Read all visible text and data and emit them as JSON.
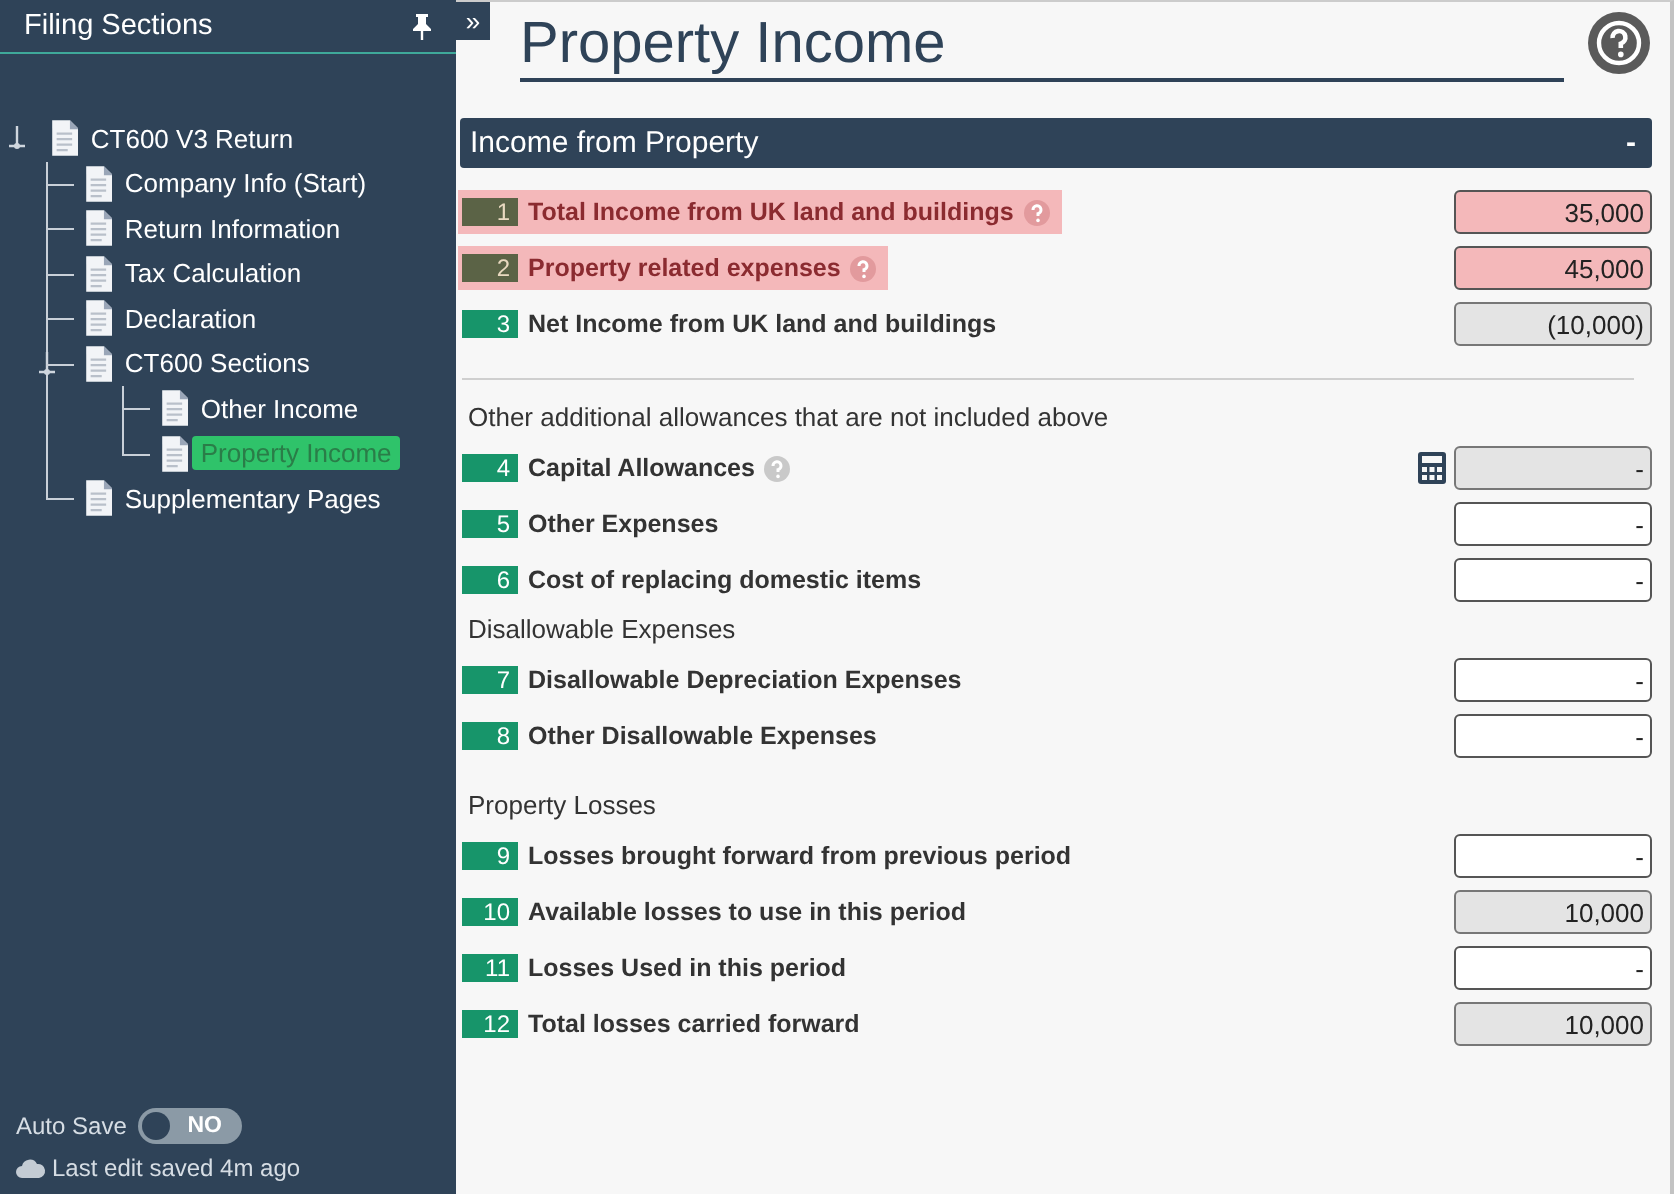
{
  "sidebar": {
    "title": "Filing Sections",
    "tree": [
      {
        "label": "CT600 V3 Return",
        "selected": false,
        "expanded": true,
        "children": [
          {
            "label": "Company Info (Start)",
            "selected": false
          },
          {
            "label": "Return Information",
            "selected": false
          },
          {
            "label": "Tax Calculation",
            "selected": false
          },
          {
            "label": "Declaration",
            "selected": false
          },
          {
            "label": "CT600 Sections",
            "selected": false,
            "expanded": true,
            "children": [
              {
                "label": "Other Income",
                "selected": false
              },
              {
                "label": "Property Income",
                "selected": true
              }
            ]
          },
          {
            "label": "Supplementary Pages",
            "selected": false
          }
        ]
      }
    ],
    "auto_save": {
      "label": "Auto Save",
      "on": false,
      "text": "NO"
    },
    "last_saved": "Last edit saved 4m ago"
  },
  "collapse_button": "»",
  "page_title": "Property Income",
  "section": {
    "title": "Income from Property",
    "toggle": "-",
    "lines": [
      {
        "kind": "line",
        "number": "1",
        "label": "Total Income from UK land and buildings",
        "help": true,
        "error": true,
        "readonly": false,
        "value": "35,000"
      },
      {
        "kind": "line",
        "number": "2",
        "label": "Property related expenses",
        "help": true,
        "error": true,
        "readonly": false,
        "value": "45,000"
      },
      {
        "kind": "line",
        "number": "3",
        "label": "Net Income from UK land and buildings",
        "help": false,
        "error": false,
        "readonly": true,
        "value": "(10,000)"
      }
    ],
    "other_items": [
      {
        "kind": "heading",
        "label": "Other additional allowances that are not included above"
      },
      {
        "kind": "line",
        "number": "4",
        "label": "Capital Allowances",
        "help": true,
        "error": false,
        "readonly": true,
        "calculator": true,
        "value": "-"
      },
      {
        "kind": "line",
        "number": "5",
        "label": "Other Expenses",
        "help": false,
        "error": false,
        "readonly": false,
        "value": "-"
      },
      {
        "kind": "line",
        "number": "6",
        "label": "Cost of replacing domestic items",
        "help": false,
        "error": false,
        "readonly": false,
        "value": "-"
      },
      {
        "kind": "heading",
        "label": "Disallowable Expenses"
      },
      {
        "kind": "line",
        "number": "7",
        "label": "Disallowable Depreciation Expenses",
        "help": false,
        "error": false,
        "readonly": false,
        "value": "-"
      },
      {
        "kind": "line",
        "number": "8",
        "label": "Other Disallowable Expenses",
        "help": false,
        "error": false,
        "readonly": false,
        "value": "-"
      },
      {
        "kind": "heading",
        "label": "Property Losses"
      },
      {
        "kind": "line",
        "number": "9",
        "label": "Losses brought forward from previous period",
        "help": false,
        "error": false,
        "readonly": false,
        "value": "-"
      },
      {
        "kind": "line",
        "number": "10",
        "label": "Available losses to use in this period",
        "help": false,
        "error": false,
        "readonly": true,
        "value": "10,000"
      },
      {
        "kind": "line",
        "number": "11",
        "label": "Losses Used in this period",
        "help": false,
        "error": false,
        "readonly": false,
        "value": "-"
      },
      {
        "kind": "line",
        "number": "12",
        "label": "Total losses carried forward",
        "help": false,
        "error": false,
        "readonly": true,
        "value": "10,000"
      }
    ]
  }
}
